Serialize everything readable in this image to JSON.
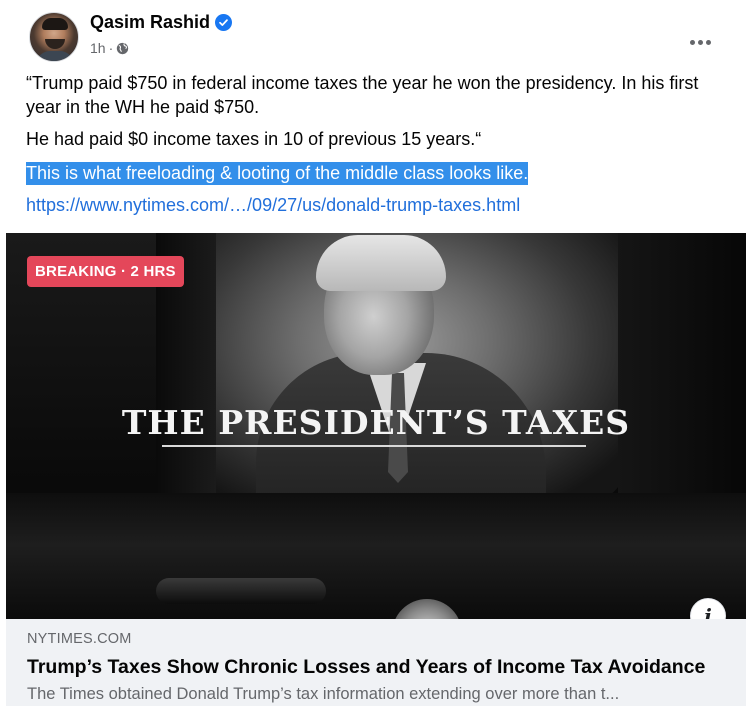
{
  "post": {
    "author": {
      "name": "Qasim Rashid",
      "verified": true,
      "avatar_icon": "profile-photo"
    },
    "meta": {
      "time": "1h",
      "separator": "·",
      "privacy_icon": "globe-icon"
    },
    "more_icon": "more-horizontal-icon",
    "paragraphs": {
      "p1": "“Trump paid $750 in federal income taxes the year he won the presidency. In his first year in the WH he paid $750.",
      "p2": "He had paid $0 income taxes in 10 of previous 15 years.“",
      "p3": "This is what freeloading & looting of the middle class looks like."
    },
    "link_text": "https://www.nytimes.com/…/09/27/us/donald-trump-taxes.html"
  },
  "image": {
    "badge": "BREAKING · 2 HRS",
    "headline": "THE PRESIDENT’S TAXES",
    "info_label": "i"
  },
  "link_card": {
    "domain": "NYTIMES.COM",
    "title": "Trump’s Taxes Show Chronic Losses and Years of Income Tax Avoidance",
    "description": "The Times obtained Donald Trump’s tax information extending over more than t..."
  },
  "colors": {
    "highlight": "#338fea",
    "link": "#216fdb",
    "badge": "#e4475a",
    "verified": "#1877f2"
  }
}
